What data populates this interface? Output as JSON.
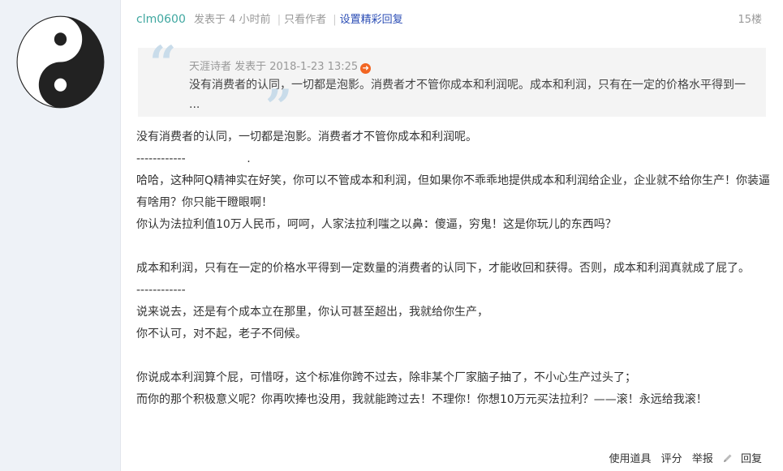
{
  "post": {
    "username": "clm0600",
    "posted": "发表于 4 小时前",
    "only_author": "只看作者",
    "set_highlight": "设置精彩回复",
    "floor": "15楼"
  },
  "quote": {
    "meta": "天涯诗者 发表于 2018-1-23 13:25",
    "text": "没有消费者的认同，一切都是泡影。消费者才不管你成本和利润呢。成本和利润，只有在一定的价格水平得到一 ..."
  },
  "body_lines": [
    "没有消费者的认同，一切都是泡影。消费者才不管你成本和利润呢。",
    "------------                 .",
    "哈哈，这种阿Q精神实在好笑，你可以不管成本和利润，但如果你不乖乖地提供成本和利润给企业，企业就不给你生产！你装逼有啥用？你只能干瞪眼啊！",
    "你认为法拉利值10万人民币，呵呵，人家法拉利嗤之以鼻：傻逼，穷鬼！这是你玩儿的东西吗？",
    "",
    "成本和利润，只有在一定的价格水平得到一定数量的消费者的认同下，才能收回和获得。否则，成本和利润真就成了屁了。",
    "------------",
    "说来说去，还是有个成本立在那里，你认可甚至超出，我就给你生产，",
    "你不认可，对不起，老子不伺候。",
    "",
    "你说成本利润算个屁，可惜呀，这个标准你跨不过去，除非某个厂家脑子抽了，不小心生产过头了；",
    "而你的那个积极意义呢？你再吹捧也没用，我就能跨过去！不理你！你想10万元买法拉利？——滚！永远给我滚！"
  ],
  "footer": {
    "use_tool": "使用道具",
    "rate": "评分",
    "report": "举报",
    "reply": "回复"
  },
  "icons": {
    "avatar": "yin-yang-icon",
    "quote_open": "quote-open-icon",
    "quote_close": "quote-close-icon",
    "jump": "jump-arrow-icon",
    "reply": "pencil-icon"
  },
  "colors": {
    "username": "#3fa7a0",
    "link": "#2b4db5",
    "quote_mark": "#c9dcea",
    "jump_arrow": "#f26522"
  }
}
